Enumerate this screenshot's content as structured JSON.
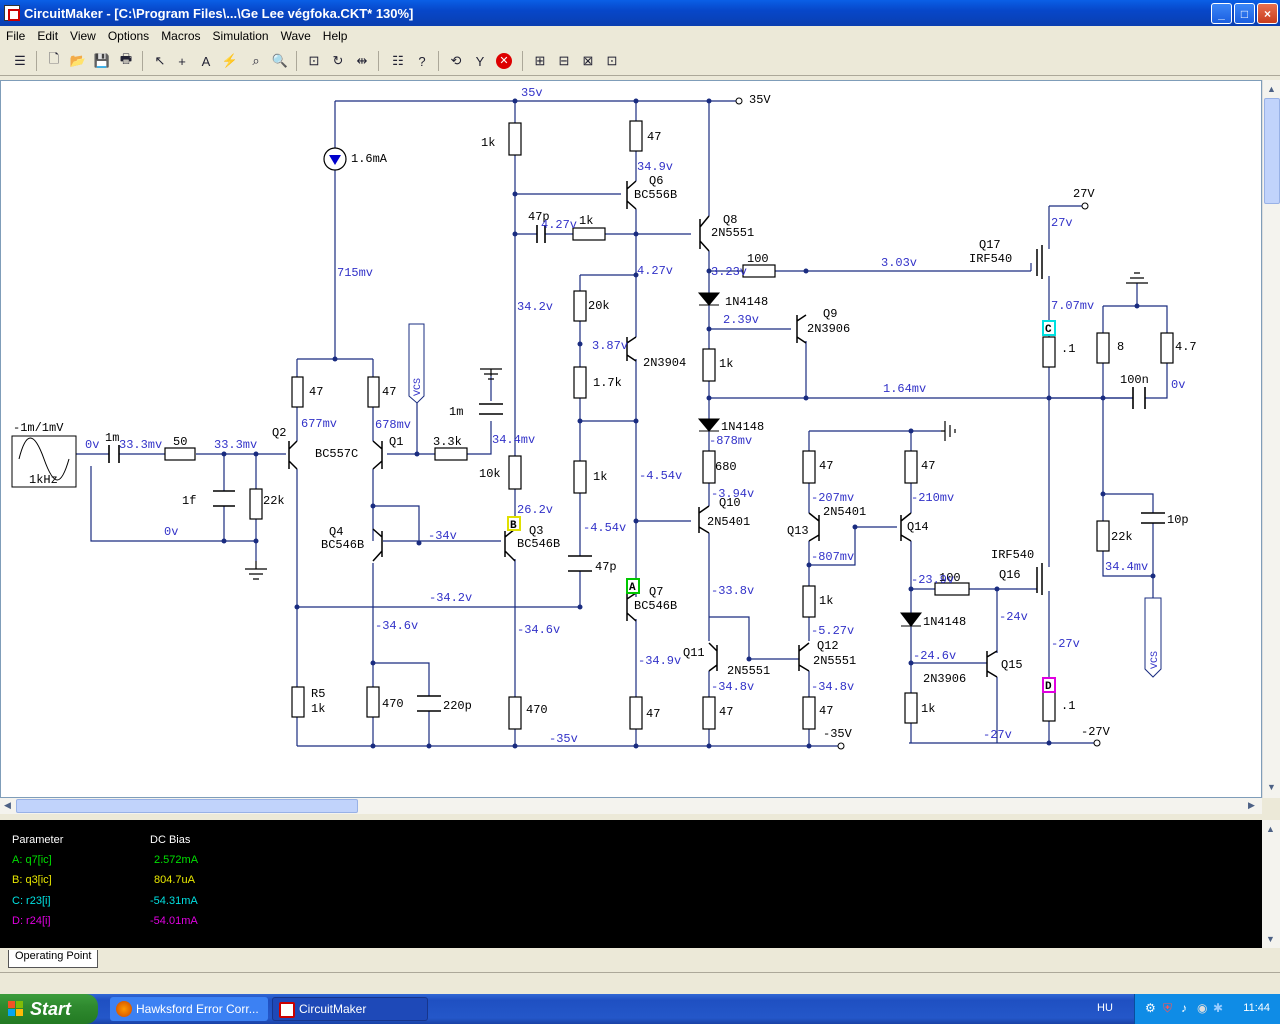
{
  "window": {
    "title": "CircuitMaker - [C:\\Program Files\\...\\Ge Lee végfoka.CKT* 130%]",
    "minimize": "_",
    "maximize": "□",
    "close": "×"
  },
  "menu": [
    "File",
    "Edit",
    "View",
    "Options",
    "Macros",
    "Simulation",
    "Wave",
    "Help"
  ],
  "toolbar_icons": [
    "macro-icon",
    "new-icon",
    "open-icon",
    "save-icon",
    "print-icon",
    "arrow-tool-icon",
    "wire-tool-icon",
    "text-tool-icon",
    "probe-tool-icon",
    "zoom-icon",
    "magnify-icon",
    "fit-icon",
    "rotate-icon",
    "mirror-icon",
    "netlist-icon",
    "help-icon",
    "reset-icon",
    "step-icon",
    "stop-icon",
    "grid1-icon",
    "grid2-icon",
    "grid3-icon",
    "grid4-icon"
  ],
  "colors": {
    "wire": "#1a2c80",
    "label": "#3232c8",
    "probe_a": "#00c800",
    "probe_b": "#e0e000",
    "probe_c": "#00e0e0",
    "probe_d": "#e000e0"
  },
  "schematic": {
    "supply_pos": "35V",
    "supply_pos_top": "35v",
    "supply_27": "27V",
    "supply_neg": "-35V",
    "supply_neg27": "-27V",
    "rail_neg": "-35v",
    "source_label": "-1m/1mV",
    "source_freq": "1kHz",
    "current_source": "1.6mA",
    "components": {
      "r_in": "50",
      "c_in": "1m",
      "c_1f": "1f",
      "r_22k": "22k",
      "r47_q2": "47",
      "r47_q1": "47",
      "r_33k": "3.3k",
      "c_1m2": "1m",
      "r_1k_top": "1k",
      "r_10k": "10k",
      "r_47_q6": "47",
      "c_47p": "47p",
      "r_1k_mid": "1k",
      "r_20k": "20k",
      "r_17k": "1.7k",
      "r_1k_low": "1k",
      "c_47p2": "47p",
      "r5": "R5",
      "r5_val": "1k",
      "r_470a": "470",
      "c_220p": "220p",
      "r_470b": "470",
      "r_47_q7": "47",
      "r_100": "100",
      "d1": "1N4148",
      "r_1k_d": "1k",
      "d2": "1N4148",
      "r_680": "680",
      "r_47_q11": "47",
      "r_47_q12": "47",
      "r_47_q13": "47",
      "r_47_q14": "47",
      "r_1k_q12": "1k",
      "r_100b": "100",
      "d3": "1N4148",
      "r_1k_q15": "1k",
      "r_8": "8",
      "r_47b": "4.7",
      "c_100n": "100n",
      "r_01a": ".1",
      "r_01b": ".1",
      "r_22k2": "22k",
      "c_10p": "10p",
      "vcs1": "VCS",
      "vcs2": "VCS"
    },
    "transistors": {
      "q1": "Q1",
      "q2": "Q2",
      "q2_type": "BC557C",
      "q3": "Q3",
      "q3_type": "BC546B",
      "q4": "Q4",
      "q4_type": "BC546B",
      "q6": "Q6",
      "q6_type": "BC556B",
      "q7": "Q7",
      "q7_type": "BC546B",
      "q8": "Q8",
      "q8_type": "2N5551",
      "q5_type": "2N3904",
      "q9": "Q9",
      "q9_type": "2N3906",
      "q10": "Q10",
      "q10_type": "2N5401",
      "q11": "Q11",
      "q11_type": "2N5551",
      "q12": "Q12",
      "q12_type": "2N5551",
      "q13": "Q13",
      "q13_type": "2N5401",
      "q14": "Q14",
      "q15": "Q15",
      "q15_type": "2N3906",
      "q16": "Q16",
      "q16_type": "IRF540",
      "q17": "Q17",
      "q17_type": "IRF540"
    },
    "voltages": {
      "v_0a": "0v",
      "v_333a": "33.3mv",
      "v_333b": "33.3mv",
      "v_0b": "0v",
      "v_715": "715mv",
      "v_677": "677mv",
      "v_678": "678mv",
      "v_344": "34.4mv",
      "v_342": "34.2v",
      "v_349": "34.9v",
      "v_427a": "4.27v",
      "v_427b": "4.27v",
      "v_387": "3.87v",
      "v_323": "3.23v",
      "v_303": "3.03v",
      "v_239": "2.39v",
      "v_164": "1.64mv",
      "v_878": "-878mv",
      "v_394": "-3.94v",
      "v_454a": "-4.54v",
      "v_454b": "-4.54v",
      "v_262": "26.2v",
      "v_34": "-34v",
      "v_342n": "-34.2v",
      "v_346a": "-34.6v",
      "v_346b": "-34.6v",
      "v_349n": "-34.9v",
      "v_338": "-33.8v",
      "v_348a": "-34.8v",
      "v_348b": "-34.8v",
      "v_207": "-207mv",
      "v_210": "-210mv",
      "v_807": "-807mv",
      "v_527": "-5.27v",
      "v_23": "-23.9v",
      "v_246": "-24.6v",
      "v_24": "-24v",
      "v_27a": "-27v",
      "v_27b": "-27v",
      "v_27pos": "27v",
      "v_707": "7.07mv",
      "v_0c": "0v",
      "v_344b": "34.4mv"
    },
    "probes": {
      "a": "A",
      "b": "B",
      "c": "C",
      "d": "D"
    }
  },
  "scope": {
    "header_param": "Parameter",
    "header_bias": "DC Bias",
    "rows": [
      {
        "param": "A: q7[ic]",
        "value": "2.572mA"
      },
      {
        "param": "B: q3[ic]",
        "value": "804.7uA"
      },
      {
        "param": "C: r23[i]",
        "value": "-54.31mA"
      },
      {
        "param": "D: r24[i]",
        "value": "-54.01mA"
      }
    ]
  },
  "tab": "Operating Point",
  "taskbar": {
    "start": "Start",
    "tasks": [
      "Hawksford Error Corr...",
      "CircuitMaker"
    ],
    "lang": "HU",
    "clock": "11:44"
  }
}
